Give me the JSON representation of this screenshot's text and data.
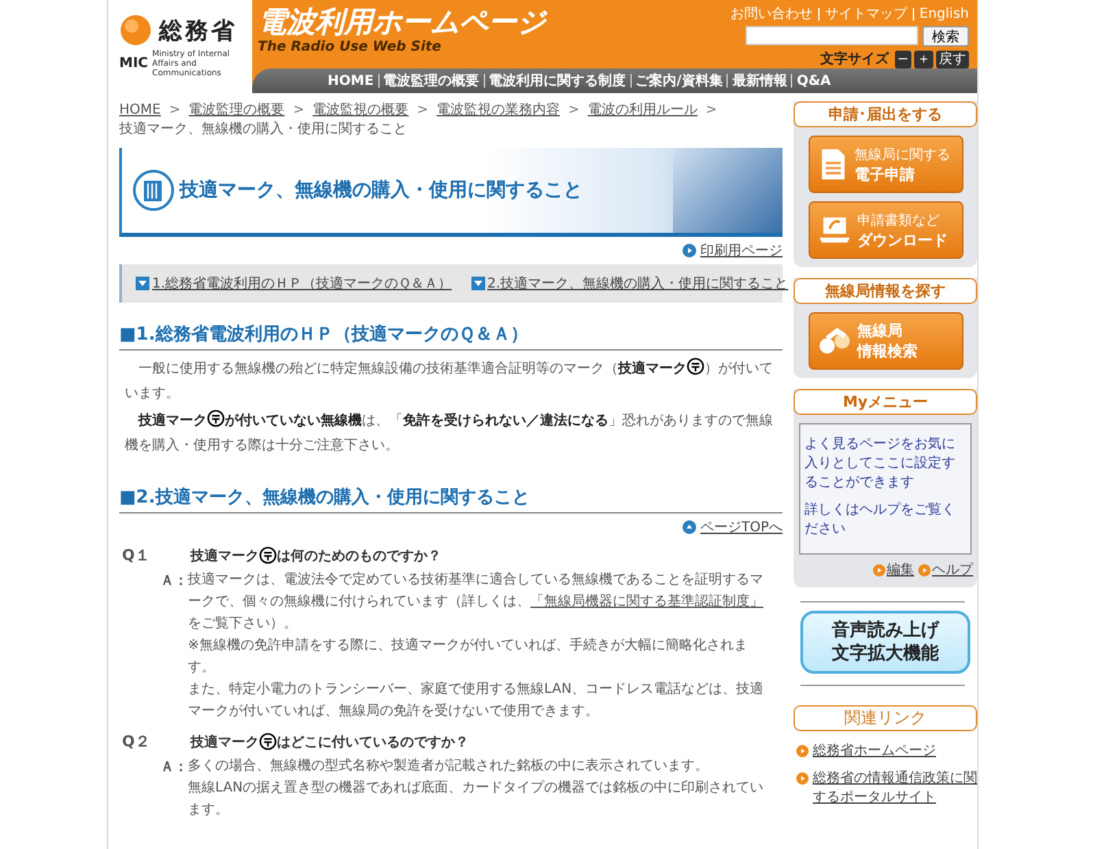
{
  "header": {
    "ministry_name": "総務省",
    "ministry_abbr": "MIC",
    "ministry_english": "Ministry of Internal Affairs and Communications",
    "site_title": "電波利用ホームページ",
    "site_subtitle": "The Radio Use Web Site",
    "top_links": [
      "お問い合わせ",
      "サイトマップ",
      "English"
    ],
    "search": {
      "button": "検索"
    },
    "font_size": {
      "label": "文字サイズ",
      "buttons": [
        "−",
        "＋",
        "戻す"
      ]
    },
    "nav": [
      "HOME",
      "電波監理の概要",
      "電波利用に関する制度",
      "ご案内/資料集",
      "最新情報",
      "Q&A"
    ]
  },
  "breadcrumb": {
    "separator": ">",
    "links": [
      "HOME",
      "電波監理の概要",
      "電波監視の概要",
      "電波監視の業務内容",
      "電波の利用ルール"
    ],
    "current": "技適マーク、無線機の購入・使用に関すること"
  },
  "page_title": "技適マーク、無線機の購入・使用に関すること",
  "print_link": "印刷用ページ",
  "toc": [
    "1.総務省電波利用のＨＰ（技適マークのＱ＆Ａ）",
    "2.技適マーク、無線機の購入・使用に関すること"
  ],
  "section1": {
    "heading": "■1.総務省電波利用のＨＰ（技適マークのＱ＆Ａ）",
    "paragraphs": [
      [
        {
          "kind": "text",
          "text": "一般に使用する無線機の殆どに特定無線設備の技術基準適合証明等のマーク（**技適マーク**"
        },
        {
          "kind": "mark"
        },
        {
          "kind": "text",
          "text": "）が付いています。"
        }
      ],
      [
        {
          "kind": "text",
          "text": "**技適マーク**"
        },
        {
          "kind": "mark"
        },
        {
          "kind": "text",
          "text": "**が付いていない無線機**は、「**免許を受けられない／違法になる**」恐れがありますので無線機を購入・使用する際は十分ご注意下さい。"
        }
      ]
    ]
  },
  "section2": {
    "heading": "■2.技適マーク、無線機の購入・使用に関すること",
    "page_top": "ページTOPへ",
    "qa": [
      {
        "q_label": "Q１",
        "question": [
          {
            "kind": "text",
            "text": "技適マーク"
          },
          {
            "kind": "mark"
          },
          {
            "kind": "text",
            "text": "は何のためのものですか？"
          }
        ],
        "a_label": "Ａ：",
        "answer": [
          {
            "text": "技適マークは、電波法令で定めている技術基準に適合している無線機であることを証明するマークで、個々の無線機に付けられています（詳しくは、",
            "link": "「無線局機器に関する基準認証制度」",
            "text_after": "をご覧下さい）。"
          },
          {
            "text": "※無線機の免許申請をする際に、技適マークが付いていれば、手続きが大幅に簡略化されます。"
          },
          {
            "text": "また、特定小電力のトランシーバー、家庭で使用する無線LAN、コードレス電話などは、技適マークが付いていれば、無線局の免許を受けないで使用できます。"
          }
        ]
      },
      {
        "q_label": "Q２",
        "question": [
          {
            "kind": "text",
            "text": "技適マーク"
          },
          {
            "kind": "mark"
          },
          {
            "kind": "text",
            "text": "はどこに付いているのですか？"
          }
        ],
        "a_label": "Ａ：",
        "answer": [
          {
            "text": "多くの場合、無線機の型式名称や製造者が記載された銘板の中に表示されています。"
          },
          {
            "text": "無線LANの据え置き型の機器であれば底面、カードタイプの機器では銘板の中に印刷されています。"
          }
        ]
      }
    ]
  },
  "sidebar": {
    "apply": {
      "heading": "申請･届出をする",
      "buttons": [
        {
          "lines": [
            "無線局に関する",
            "電子申請"
          ]
        },
        {
          "lines": [
            "申請書類など",
            "ダウンロード"
          ]
        }
      ]
    },
    "search_info": {
      "heading": "無線局情報を探す",
      "buttons": [
        {
          "lines": [
            "無線局",
            "情報検索"
          ]
        }
      ]
    },
    "my_menu": {
      "heading": "Myメニュー",
      "texts": [
        "よく見るページをお気に入りとしてここに設定することができます",
        "詳しくはヘルプをご覧ください"
      ],
      "links": [
        "編集",
        "ヘルプ"
      ]
    },
    "accessibility_banner": [
      "音声読み上げ",
      "文字拡大機能"
    ],
    "related": {
      "heading": "関連リンク",
      "links": [
        "総務省ホームページ",
        "総務省の情報通信政策に関するポータルサイト"
      ]
    }
  }
}
